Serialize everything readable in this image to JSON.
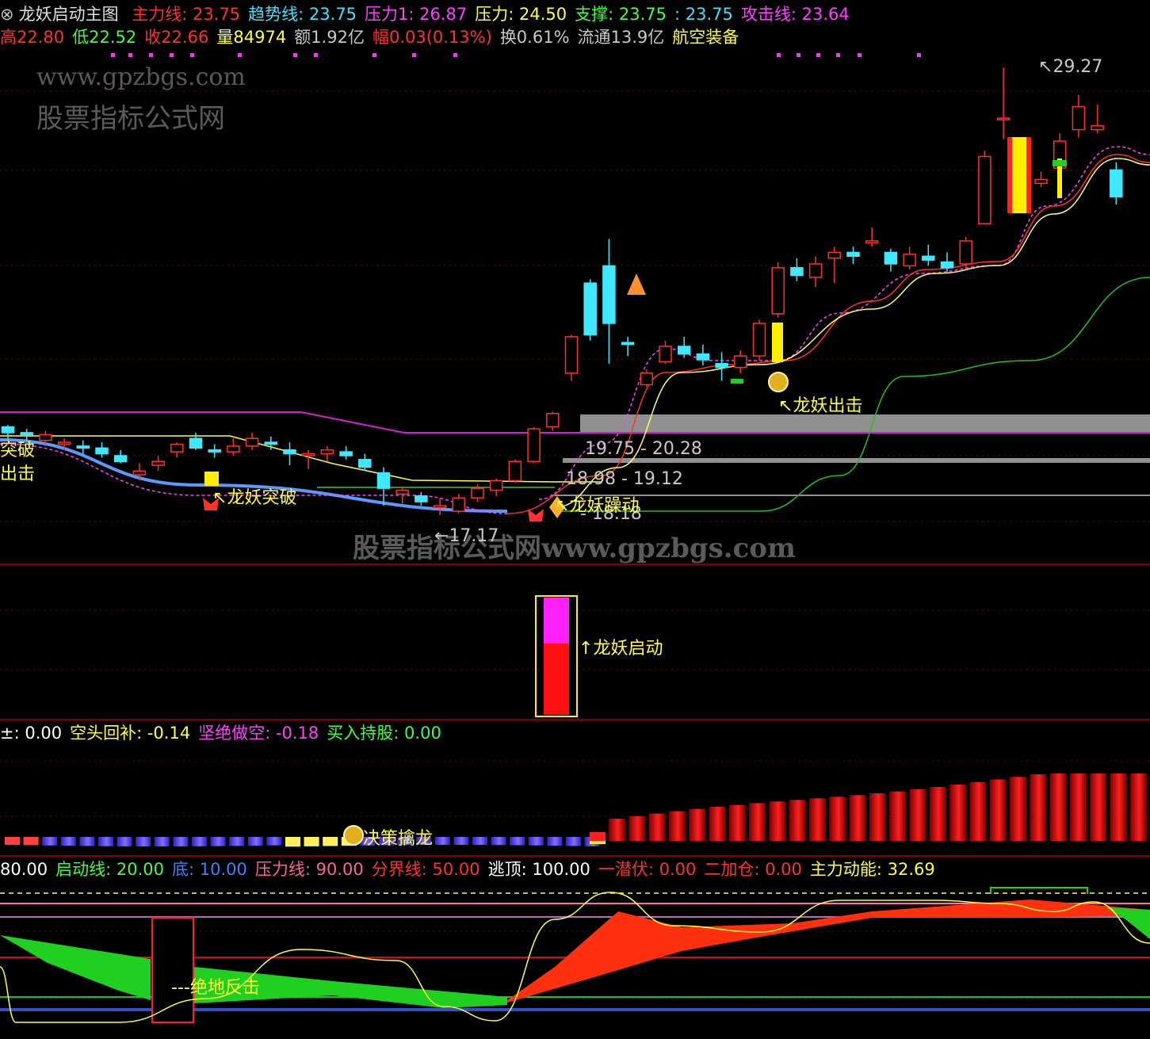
{
  "header1": {
    "title": "龙妖启动主图",
    "items": [
      {
        "text": "主力线: 23.75",
        "color": "#ff3030"
      },
      {
        "text": "趋势线: 23.75",
        "color": "#40e0ff"
      },
      {
        "text": "压力1: 26.87",
        "color": "#ff40ff"
      },
      {
        "text": "压力: 24.50",
        "color": "#ffff40"
      },
      {
        "text": "支撑: 23.75",
        "color": "#40ff40"
      },
      {
        "text": ": 23.75",
        "color": "#40e0ff"
      },
      {
        "text": "攻击线: 23.64",
        "color": "#ff40ff"
      }
    ]
  },
  "header2": {
    "items": [
      {
        "text": "高22.80",
        "color": "#ff3030"
      },
      {
        "text": "低22.52",
        "color": "#40ff40"
      },
      {
        "text": "收22.66",
        "color": "#ff3030"
      },
      {
        "text": "量84974",
        "color": "#ffff40"
      },
      {
        "text": "额1.92亿",
        "color": "#c8c8c8"
      },
      {
        "text": "幅0.03(0.13%)",
        "color": "#ff3030"
      },
      {
        "text": "换0.61%",
        "color": "#c8c8c8"
      },
      {
        "text": "流通13.9亿",
        "color": "#c8c8c8"
      },
      {
        "text": "航空装备",
        "color": "#ffff40"
      }
    ]
  },
  "watermarks": {
    "top_url": "www.gpzbgs.com",
    "top_name": "股票指标公式网",
    "middle": "股票指标公式网www.gpzbgs.com"
  },
  "price_labels": {
    "high": "29.27",
    "low": "17.17",
    "zone1": "19.75 - 20.28",
    "zone2": "18.98 - 19.12",
    "zone3": "- 18.18"
  },
  "signals": {
    "breakout_left": "突破",
    "attack_left": "出击",
    "dragon_breakout": "龙妖突破",
    "dragon_move": "龙妖躁动",
    "dragon_attack": "龙妖出击",
    "dragon_start": "龙妖启动",
    "catch_dragon": "决策擒龙",
    "reversal": "绝地反击"
  },
  "panel3_header": [
    {
      "text": "±: 0.00",
      "color": "#ffffff"
    },
    {
      "text": "空头回补: -0.14",
      "color": "#ffff40"
    },
    {
      "text": "坚绝做空: -0.18",
      "color": "#ff40ff"
    },
    {
      "text": "买入持股: 0.00",
      "color": "#40ff40"
    }
  ],
  "panel4_header": [
    {
      "text": "80.00",
      "color": "#ffffff"
    },
    {
      "text": "启动线: 20.00",
      "color": "#40ff40"
    },
    {
      "text": "底: 10.00",
      "color": "#4080ff"
    },
    {
      "text": "压力线: 90.00",
      "color": "#ff60a0"
    },
    {
      "text": "分界线: 50.00",
      "color": "#ff3030"
    },
    {
      "text": "逃顶: 100.00",
      "color": "#ffffff"
    },
    {
      "text": "一潜伏: 0.00",
      "color": "#ff3030"
    },
    {
      "text": "二加仓: 0.00",
      "color": "#ff3030"
    },
    {
      "text": "主力动能: 32.69",
      "color": "#ffff40"
    }
  ],
  "chart_data": {
    "type": "candlestick",
    "candles": [
      [
        19.9,
        19.95,
        19.55,
        19.75
      ],
      [
        19.75,
        19.85,
        19.55,
        19.7
      ],
      [
        19.55,
        19.8,
        19.4,
        19.7
      ],
      [
        19.45,
        19.6,
        19.3,
        19.5
      ],
      [
        19.4,
        19.55,
        19.2,
        19.35
      ],
      [
        19.35,
        19.5,
        19.1,
        19.2
      ],
      [
        19.15,
        19.3,
        18.95,
        19.0
      ],
      [
        18.65,
        18.95,
        18.5,
        18.75
      ],
      [
        18.9,
        19.15,
        18.75,
        19.0
      ],
      [
        19.25,
        19.5,
        19.1,
        19.45
      ],
      [
        19.6,
        19.75,
        19.3,
        19.35
      ],
      [
        19.3,
        19.45,
        19.1,
        19.25
      ],
      [
        19.25,
        19.6,
        19.15,
        19.4
      ],
      [
        19.4,
        19.75,
        19.3,
        19.6
      ],
      [
        19.5,
        19.65,
        19.3,
        19.45
      ],
      [
        19.3,
        19.5,
        18.9,
        19.2
      ],
      [
        19.15,
        19.3,
        18.8,
        19.2
      ],
      [
        19.2,
        19.4,
        19.0,
        19.3
      ],
      [
        19.25,
        19.4,
        19.05,
        19.15
      ],
      [
        19.05,
        19.2,
        18.75,
        18.85
      ],
      [
        18.7,
        18.85,
        17.85,
        18.3
      ],
      [
        18.15,
        18.35,
        17.9,
        18.25
      ],
      [
        18.1,
        18.2,
        17.85,
        17.95
      ],
      [
        17.8,
        18.05,
        17.6,
        17.85
      ],
      [
        17.7,
        18.15,
        17.65,
        18.05
      ],
      [
        18.05,
        18.4,
        17.95,
        18.3
      ],
      [
        18.25,
        18.55,
        18.1,
        18.5
      ],
      [
        18.5,
        19.05,
        18.45,
        19.0
      ],
      [
        19.0,
        19.9,
        18.95,
        19.85
      ],
      [
        19.9,
        20.3,
        19.8,
        20.25
      ],
      [
        21.3,
        22.3,
        21.1,
        22.25
      ],
      [
        23.65,
        23.75,
        22.15,
        22.3
      ],
      [
        24.1,
        24.8,
        21.55,
        22.6
      ],
      [
        22.1,
        22.25,
        21.75,
        22.05
      ],
      [
        21.0,
        21.4,
        20.95,
        21.3
      ],
      [
        21.6,
        22.15,
        21.55,
        22.0
      ],
      [
        22.0,
        22.25,
        21.7,
        21.8
      ],
      [
        21.8,
        22.05,
        21.5,
        21.65
      ],
      [
        21.55,
        21.85,
        21.1,
        21.45
      ],
      [
        21.45,
        21.9,
        21.3,
        21.75
      ],
      [
        21.75,
        22.7,
        21.65,
        22.6
      ],
      [
        22.85,
        24.2,
        22.75,
        24.05
      ],
      [
        24.05,
        24.3,
        23.7,
        23.85
      ],
      [
        23.8,
        24.35,
        23.55,
        24.15
      ],
      [
        24.3,
        24.6,
        23.65,
        24.45
      ],
      [
        24.45,
        24.6,
        24.15,
        24.35
      ],
      [
        24.7,
        25.1,
        24.6,
        24.75
      ],
      [
        24.45,
        24.55,
        23.95,
        24.15
      ],
      [
        24.1,
        24.6,
        24.0,
        24.4
      ],
      [
        24.35,
        24.65,
        24.1,
        24.25
      ],
      [
        24.2,
        24.45,
        23.95,
        24.05
      ],
      [
        24.15,
        24.85,
        24.05,
        24.75
      ],
      [
        25.2,
        27.1,
        25.2,
        26.95
      ],
      [
        27.95,
        29.27,
        27.4,
        27.95
      ],
      [
        26.1,
        26.9,
        25.6,
        26.15
      ],
      [
        26.25,
        26.55,
        26.15,
        26.35
      ],
      [
        26.65,
        27.55,
        26.45,
        27.35
      ],
      [
        27.65,
        28.55,
        27.45,
        28.25
      ],
      [
        27.65,
        28.3,
        27.55,
        27.75
      ],
      [
        26.6,
        26.8,
        25.7,
        25.9
      ]
    ]
  }
}
